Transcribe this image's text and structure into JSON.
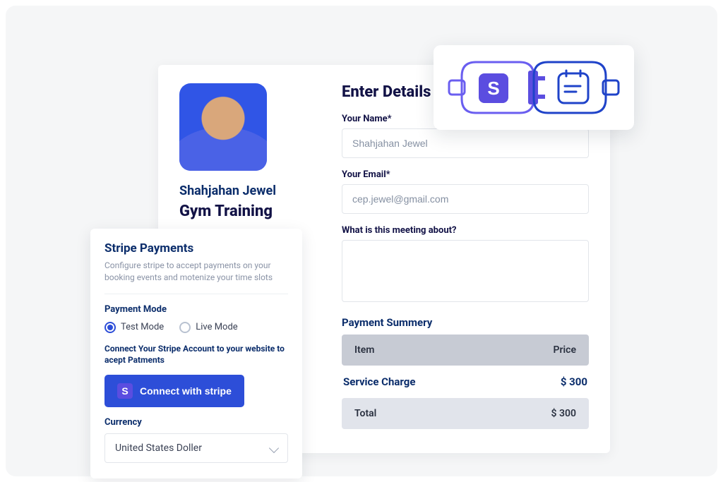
{
  "booking": {
    "person_name": "Shahjahan Jewel",
    "event_title": "Gym Training",
    "heading": "Enter Details",
    "fields": {
      "name_label": "Your Name*",
      "name_value": "Shahjahan Jewel",
      "email_label": "Your Email*",
      "email_value": "cep.jewel@gmail.com",
      "about_label": "What is this meeting about?"
    },
    "summary": {
      "title": "Payment Summery",
      "head_item": "Item",
      "head_price": "Price",
      "row_label": "Service Charge",
      "row_value": "$ 300",
      "total_label": "Total",
      "total_value": "$ 300"
    }
  },
  "stripe": {
    "title": "Stripe Payments",
    "description": "Configure stripe to accept payments on your booking events and motenize your time slots",
    "mode_label": "Payment Mode",
    "test_mode": "Test Mode",
    "live_mode": "Live Mode",
    "connect_note": "Connect Your Stripe Account to your website to acept Patments",
    "connect_button": "Connect with stripe",
    "currency_label": "Currency",
    "currency_value": "United States Doller"
  },
  "colors": {
    "primary": "#2d4ed8",
    "violet": "#5b4de0",
    "heading": "#121246",
    "navy": "#0b2d6b"
  }
}
